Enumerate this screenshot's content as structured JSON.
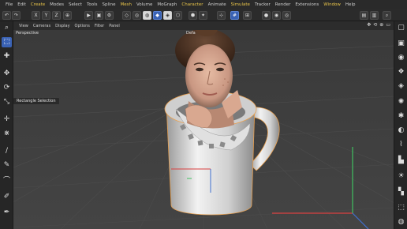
{
  "menu": [
    "File",
    "Edit",
    "Create",
    "Modes",
    "Select",
    "Tools",
    "Spline",
    "Mesh",
    "Volume",
    "MoGraph",
    "Character",
    "Animate",
    "Simulate",
    "Tracker",
    "Render",
    "Extensions",
    "Window",
    "Help"
  ],
  "menu_highlight": [
    "Create",
    "Mesh",
    "Character",
    "Simulate",
    "Window"
  ],
  "toolbar": {
    "axis_x": "X",
    "axis_y": "Y",
    "axis_z": "Z"
  },
  "viewport_menu": [
    "View",
    "Cameras",
    "Display",
    "Options",
    "Filter",
    "Panel"
  ],
  "viewport": {
    "camera_label": "Perspective",
    "camera_name": "Defa",
    "hud_tool": "Rectangle Selection"
  },
  "colors": {
    "accent": "#3a62b4",
    "highlight_menu": "#e8c44a",
    "grid": "#4a4a4a",
    "selection_outline": "#e8a050",
    "axis_x": "#d94040",
    "axis_y": "#40c060",
    "axis_z": "#4070d0"
  }
}
